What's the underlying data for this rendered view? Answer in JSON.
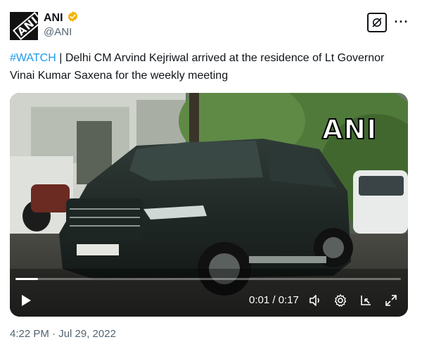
{
  "author": {
    "display_name": "ANI",
    "handle": "@ANI",
    "avatar_icon": "ani-logo",
    "avatar_text": "ANI",
    "verified_icon": "verified-badge-icon",
    "verified_color": "#f4b400"
  },
  "header_actions": {
    "grok_icon": "grok-icon",
    "more_icon": "more-icon",
    "more_label": "···"
  },
  "tweet": {
    "hashtag": "#WATCH",
    "body": " | Delhi CM Arvind Kejriwal arrived at the residence of Lt Governor Vinai Kumar Saxena for the weekly meeting",
    "hashtag_color": "#1d9bf0"
  },
  "video": {
    "watermark": "ANI",
    "current_time": "0:01",
    "duration": "0:17",
    "time_display": "0:01 / 0:17",
    "progress": 0.0588,
    "controls": [
      "play-icon",
      "volume-icon",
      "settings-gear-icon",
      "pop-out-icon",
      "fullscreen-icon"
    ]
  },
  "meta": {
    "timestamp": "4:22 PM · Jul 29, 2022"
  }
}
